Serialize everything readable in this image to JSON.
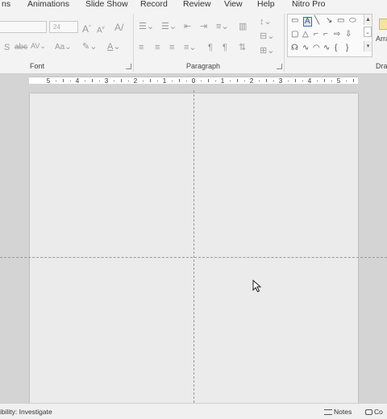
{
  "tabs": [
    {
      "label": "ns"
    },
    {
      "label": "Animations"
    },
    {
      "label": "Slide Show"
    },
    {
      "label": "Record"
    },
    {
      "label": "Review"
    },
    {
      "label": "View"
    },
    {
      "label": "Help"
    },
    {
      "label": "Nitro Pro"
    }
  ],
  "ribbon": {
    "font": {
      "group_label": "Font",
      "font_size_value": "24"
    },
    "paragraph": {
      "group_label": "Paragraph"
    },
    "drawing": {
      "group_label_partial": "Dra",
      "arrange_label_partial": "Arra"
    }
  },
  "ruler": {
    "labels": [
      "5",
      "4",
      "3",
      "2",
      "1",
      "0",
      "1",
      "2",
      "3",
      "4",
      "5"
    ]
  },
  "statusbar": {
    "accessibility": "ibility: Investigate",
    "notes": "Notes",
    "comments_partial": "Co"
  },
  "icons": {
    "font_grow": "font-size-increase-icon",
    "font_shrink": "font-size-decrease-icon",
    "clear_format": "clear-formatting-icon",
    "strikethrough": "strikethrough-icon",
    "char_spacing": "character-spacing-icon",
    "change_case": "change-case-icon",
    "highlight": "highlight-icon",
    "font_color": "font-color-icon"
  }
}
